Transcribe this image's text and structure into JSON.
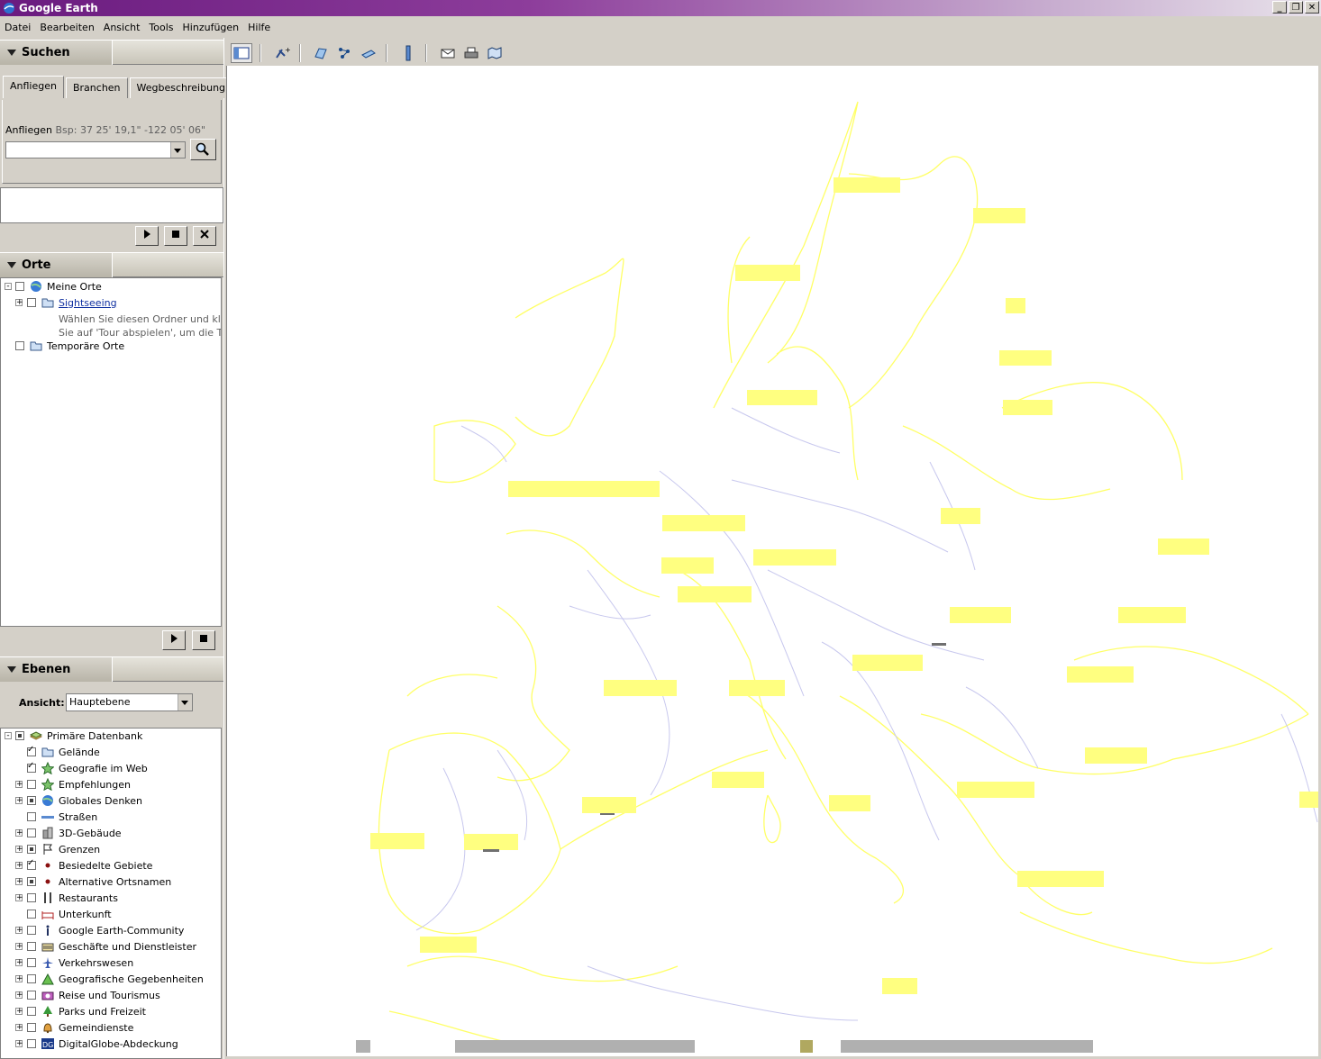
{
  "window": {
    "title": "Google Earth",
    "buttons": [
      "_",
      "❐",
      "✕"
    ]
  },
  "menu": [
    "Datei",
    "Bearbeiten",
    "Ansicht",
    "Tools",
    "Hinzufügen",
    "Hilfe"
  ],
  "search": {
    "header": "Suchen",
    "tabs": [
      "Anfliegen",
      "Branchen",
      "Wegbeschreibung"
    ],
    "fly_label": "Anfliegen",
    "fly_hint": "Bsp: 37 25' 19,1\" -122 05' 06\"",
    "fly_value": ""
  },
  "places": {
    "header": "Orte",
    "items": [
      {
        "label": "Meine Orte",
        "checked": false
      },
      {
        "label": "Sightseeing",
        "checked": false
      },
      {
        "label": "Wählen Sie diesen Ordner und klicken",
        "checked": false
      },
      {
        "label": "Sie auf 'Tour abspielen', um die Tour z",
        "checked": false
      },
      {
        "label": "Temporäre Orte",
        "checked": false
      }
    ]
  },
  "layers": {
    "header": "Ebenen",
    "view_label": "Ansicht:",
    "view_value": "Hauptebene",
    "items": [
      {
        "label": "Primäre Datenbank",
        "state": "partial",
        "icon": "layers-icon"
      },
      {
        "label": "Gelände",
        "state": "checked",
        "icon": "folder-icon"
      },
      {
        "label": "Geografie im Web",
        "state": "checked",
        "icon": "star-icon"
      },
      {
        "label": "Empfehlungen",
        "state": "unchecked",
        "icon": "star-icon"
      },
      {
        "label": "Globales Denken",
        "state": "partial",
        "icon": "globe-icon"
      },
      {
        "label": "Straßen",
        "state": "unchecked",
        "icon": "road-icon"
      },
      {
        "label": "3D-Gebäude",
        "state": "unchecked",
        "icon": "building-icon"
      },
      {
        "label": "Grenzen",
        "state": "partial",
        "icon": "flag-icon"
      },
      {
        "label": "Besiedelte Gebiete",
        "state": "checked",
        "icon": "dot-icon"
      },
      {
        "label": "Alternative Ortsnamen",
        "state": "partial",
        "icon": "dot-icon"
      },
      {
        "label": "Restaurants",
        "state": "unchecked",
        "icon": "fork-icon"
      },
      {
        "label": "Unterkunft",
        "state": "unchecked",
        "icon": "bed-icon"
      },
      {
        "label": "Google Earth-Community",
        "state": "unchecked",
        "icon": "info-icon"
      },
      {
        "label": "Geschäfte und Dienstleister",
        "state": "unchecked",
        "icon": "shop-icon"
      },
      {
        "label": "Verkehrswesen",
        "state": "unchecked",
        "icon": "plane-icon"
      },
      {
        "label": "Geografische Gegebenheiten",
        "state": "unchecked",
        "icon": "mountain-icon"
      },
      {
        "label": "Reise und Tourismus",
        "state": "unchecked",
        "icon": "camera-icon"
      },
      {
        "label": "Parks und Freizeit",
        "state": "unchecked",
        "icon": "tree-icon"
      },
      {
        "label": "Gemeindienste",
        "state": "unchecked",
        "icon": "bell-icon"
      },
      {
        "label": "DigitalGlobe-Abdeckung",
        "state": "unchecked",
        "icon": "dg-icon"
      }
    ]
  },
  "toolbar": [
    "sidebar-toggle-icon",
    "placemark-icon",
    "polygon-icon",
    "path-icon",
    "overlay-icon",
    "ruler-icon",
    "email-icon",
    "print-icon",
    "maps-icon"
  ],
  "colors": {
    "coast": "#ffff66",
    "borders": "#c8c8ee",
    "label_box": "#ffff80"
  }
}
